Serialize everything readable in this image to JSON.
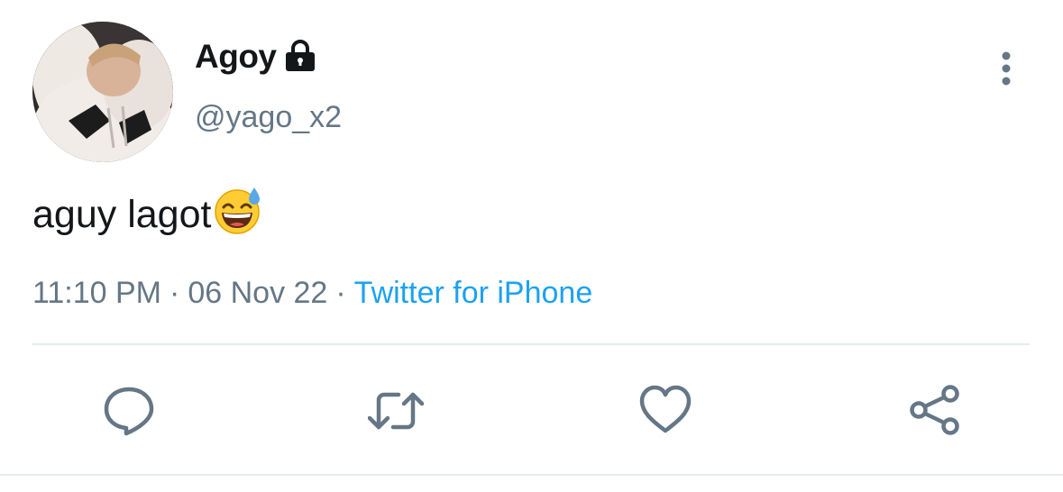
{
  "tweet": {
    "author": {
      "display_name": "Agoy",
      "handle": "@yago_x2",
      "protected_icon": "lock-icon",
      "avatar_icon": "avatar-photo"
    },
    "text": "aguy lagot",
    "emoji": "grinning-face-with-sweat",
    "time": "11:10 PM",
    "date": "06 Nov 22",
    "separator": "·",
    "source": "Twitter for iPhone"
  },
  "actions": [
    {
      "name": "reply",
      "icon": "reply-icon"
    },
    {
      "name": "retweet",
      "icon": "retweet-icon"
    },
    {
      "name": "like",
      "icon": "heart-icon"
    },
    {
      "name": "share",
      "icon": "share-icon"
    }
  ],
  "menu": {
    "icon": "more-vertical-icon"
  },
  "colors": {
    "text": "#14171a",
    "secondary": "#657786",
    "link": "#1da1f2",
    "divider": "#e6ecf0",
    "icon": "#657786"
  }
}
